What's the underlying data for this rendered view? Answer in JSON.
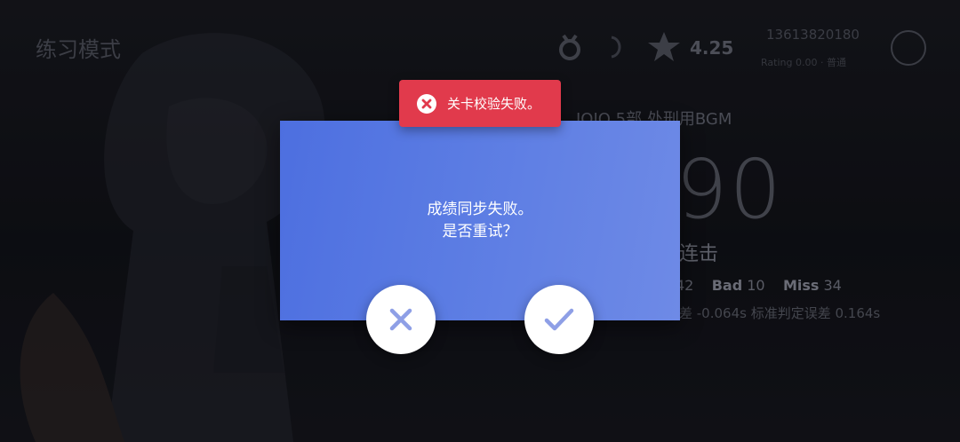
{
  "background": {
    "title": "练习模式",
    "rating": "4.25",
    "user_id": "13613820180",
    "user_sub": "Rating 0.00 · 普通",
    "song_name": "JOJO 5部 处刑用BGM",
    "score": "90",
    "combo_label": "连击",
    "stats": {
      "perfect_value": "42",
      "bad_label": "Bad",
      "bad_value": "10",
      "miss_label": "Miss",
      "miss_value": "34"
    },
    "offset_text": "差 -0.064s  标准判定误差 0.164s"
  },
  "toast": {
    "message": "关卡校验失败。",
    "icon": "error-x-icon",
    "color": "#e13a4c"
  },
  "dialog": {
    "line1": "成绩同步失败。",
    "line2": "是否重试？",
    "color": "#5b7ce3",
    "cancel_icon": "close-icon",
    "confirm_icon": "check-icon"
  }
}
